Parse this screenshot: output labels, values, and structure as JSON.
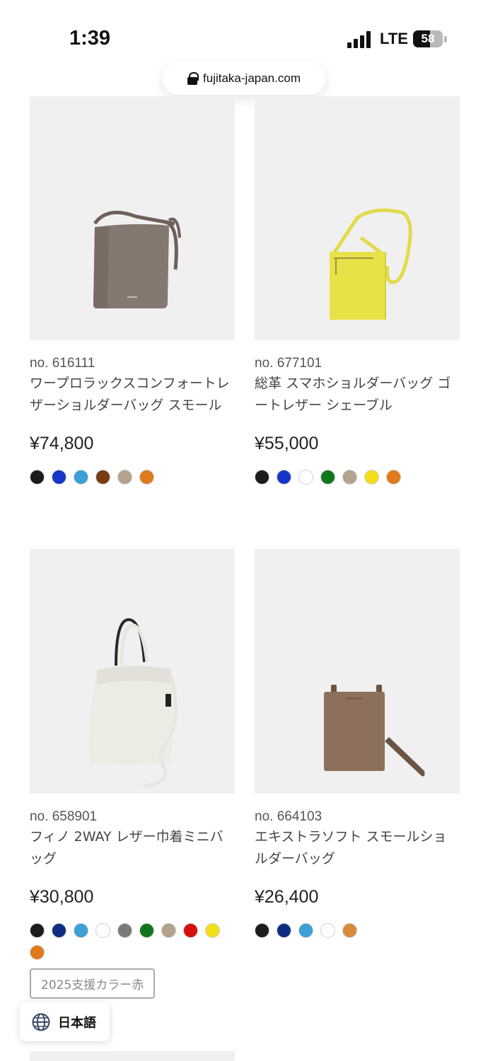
{
  "status": {
    "time": "1:39",
    "network": "LTE",
    "battery": "58",
    "battery_level": 0.58
  },
  "browser": {
    "url": "fujitaka-japan.com"
  },
  "products": [
    {
      "number": "no. 616111",
      "name": "ワープロラックスコンフォートレザーショルダーバッグ スモール",
      "price": "¥74,800",
      "colors": [
        "#1c1c1c",
        "#1536c9",
        "#3c9fd6",
        "#7a3a12",
        "#b3a28d",
        "#e07a1c"
      ]
    },
    {
      "number": "no. 677101",
      "name": "総革 スマホショルダーバッグ ゴートレザー シェーブル",
      "price": "¥55,000",
      "colors": [
        "#1c1c1c",
        "#1536c9",
        "#ffffff",
        "#11771d",
        "#b3a28d",
        "#f2df1a",
        "#e07a1c"
      ]
    },
    {
      "number": "no. 658901",
      "name": "フィノ 2WAY レザー巾着ミニバッグ",
      "price": "¥30,800",
      "colors": [
        "#1c1c1c",
        "#0f2d80",
        "#3c9fd6",
        "#ffffff",
        "#7a7a7a",
        "#11771d",
        "#b3a28d",
        "#d61010",
        "#f2df1a",
        "#e07a1c"
      ],
      "tag": "2025支援カラー赤"
    },
    {
      "number": "no. 664103",
      "name": "エキストラソフト スモールショルダーバッグ",
      "price": "¥26,400",
      "colors": [
        "#1c1c1c",
        "#0f2d80",
        "#3c9fd6",
        "#ffffff",
        "#d98a3c"
      ]
    }
  ],
  "language": {
    "label": "日本語"
  }
}
